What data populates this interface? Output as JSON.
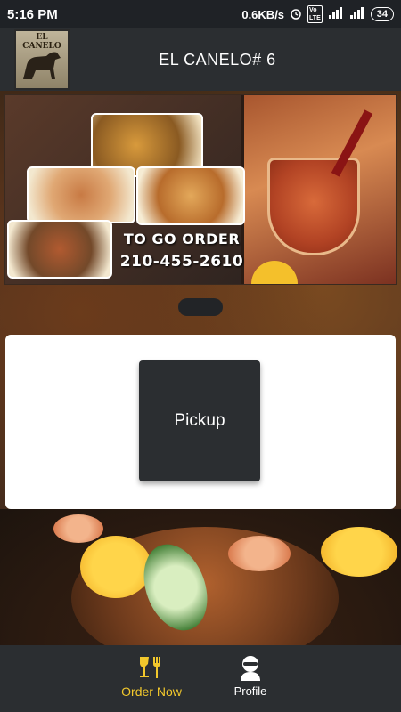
{
  "status_bar": {
    "time": "5:16 PM",
    "net_speed": "0.6KB/s",
    "volte": "VoLTE",
    "network": "4G",
    "battery": "34"
  },
  "header": {
    "logo_text": "EL CANELO",
    "title": "EL CANELO# 6"
  },
  "banner": {
    "promo_line1": "TO GO ORDER",
    "promo_line2": "210-455-2610"
  },
  "card": {
    "pickup_label": "Pickup"
  },
  "bottom_nav": {
    "items": [
      {
        "label": "Order Now",
        "icon": "food-drink-icon",
        "active": true,
        "active_color": "#f2c82c"
      },
      {
        "label": "Profile",
        "icon": "profile-icon",
        "active": false
      }
    ]
  }
}
